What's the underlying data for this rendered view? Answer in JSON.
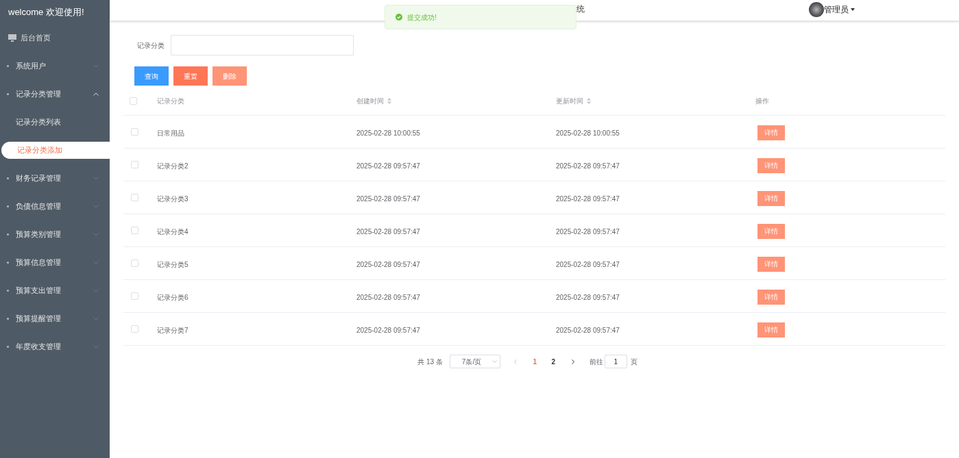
{
  "sidebar": {
    "title": "welcome 欢迎使用!",
    "home": "后台首页",
    "menus": [
      {
        "label": "系统用户",
        "expanded": false
      },
      {
        "label": "记录分类管理",
        "expanded": true,
        "children": [
          {
            "label": "记录分类列表",
            "selected": false
          },
          {
            "label": "记录分类添加",
            "selected": true
          }
        ]
      },
      {
        "label": "财务记录管理",
        "expanded": false
      },
      {
        "label": "负债信息管理",
        "expanded": false
      },
      {
        "label": "预算类别管理",
        "expanded": false
      },
      {
        "label": "预算信息管理",
        "expanded": false
      },
      {
        "label": "预算支出管理",
        "expanded": false
      },
      {
        "label": "预算提醒管理",
        "expanded": false
      },
      {
        "label": "年度收支管理",
        "expanded": false
      }
    ]
  },
  "header": {
    "title_visible": "统",
    "user": "管理员"
  },
  "toast": {
    "message": "提交成功!"
  },
  "search": {
    "label": "记录分类"
  },
  "buttons": [
    {
      "label": "查询",
      "kind": "primary"
    },
    {
      "label": "重置",
      "kind": "reset"
    },
    {
      "label": "删除",
      "kind": "delete"
    }
  ],
  "table": {
    "all_checked": false,
    "columns": [
      {
        "label": "记录分类",
        "sortable": false
      },
      {
        "label": "创建时间",
        "sortable": true
      },
      {
        "label": "更新时间",
        "sortable": true
      },
      {
        "label": "操作",
        "sortable": false
      }
    ],
    "rows": [
      {
        "checked": false,
        "cells": [
          "日常用品",
          "2025-02-28 10:00:55",
          "2025-02-28 10:00:55"
        ],
        "action": "详情"
      },
      {
        "checked": false,
        "cells": [
          "记录分类2",
          "2025-02-28 09:57:47",
          "2025-02-28 09:57:47"
        ],
        "action": "详情"
      },
      {
        "checked": false,
        "cells": [
          "记录分类3",
          "2025-02-28 09:57:47",
          "2025-02-28 09:57:47"
        ],
        "action": "详情"
      },
      {
        "checked": false,
        "cells": [
          "记录分类4",
          "2025-02-28 09:57:47",
          "2025-02-28 09:57:47"
        ],
        "action": "详情"
      },
      {
        "checked": false,
        "cells": [
          "记录分类5",
          "2025-02-28 09:57:47",
          "2025-02-28 09:57:47"
        ],
        "action": "详情"
      },
      {
        "checked": false,
        "cells": [
          "记录分类6",
          "2025-02-28 09:57:47",
          "2025-02-28 09:57:47"
        ],
        "action": "详情"
      },
      {
        "checked": false,
        "cells": [
          "记录分类7",
          "2025-02-28 09:57:47",
          "2025-02-28 09:57:47"
        ],
        "action": "详情"
      }
    ]
  },
  "pagination": {
    "total": "共 13 条",
    "page_size": "7条/页",
    "pages": [
      {
        "label": "1",
        "selected": true
      },
      {
        "label": "2",
        "selected": false
      }
    ],
    "goto_label": "前往",
    "goto_value": "1",
    "goto_suffix": "页"
  }
}
